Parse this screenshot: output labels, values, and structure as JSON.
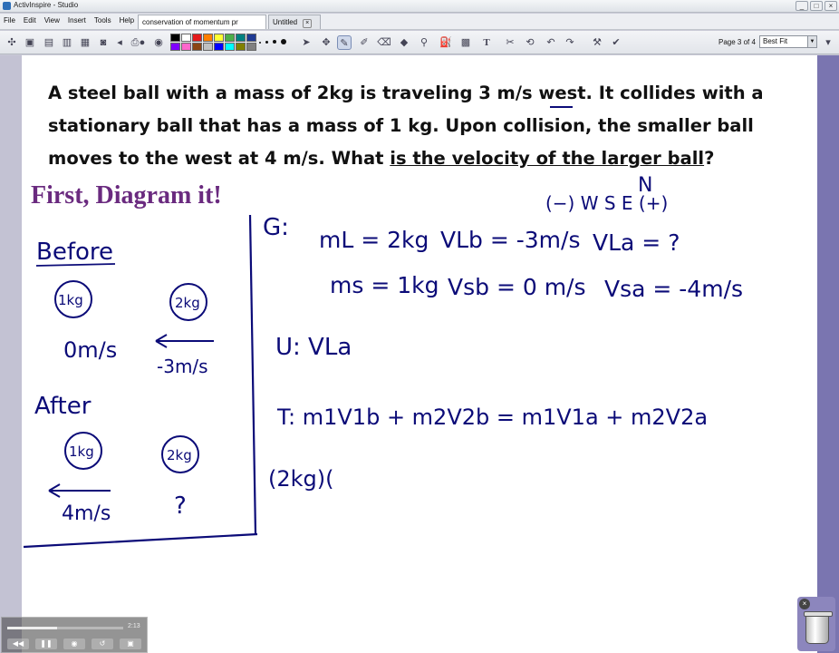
{
  "window": {
    "title": "ActivInspire - Studio",
    "controls": [
      "_",
      "□",
      "×"
    ]
  },
  "menu": [
    "File",
    "Edit",
    "View",
    "Insert",
    "Tools",
    "Help"
  ],
  "tabs": [
    {
      "label": "conservation of momentum pr"
    },
    {
      "label": "Untitled"
    }
  ],
  "toolbar": {
    "page_info": "Page 3 of 4",
    "zoom": "Best Fit",
    "palette": [
      "#000000",
      "#ffffff",
      "#e41a1c",
      "#ff7f00",
      "#ffff33",
      "#4daf4a",
      "#008080",
      "#1f3a93",
      "#7f00ff",
      "#ff66cc",
      "#8b4513",
      "#c0c0c0",
      "#0000ff",
      "#00ffff",
      "#808000",
      "#808080"
    ]
  },
  "page": {
    "question": {
      "part1": "A steel ball with a mass of 2kg is traveling 3 m/s west. It collides with a stationary ball that has a mass of 1 kg. Upon collision, the smaller ball moves to the west at 4 m/s. What ",
      "underlined": "is the velocity of the larger ball",
      "part2": "?"
    },
    "heading": "First, Diagram it!",
    "handwriting": {
      "before": "Before",
      "after": "After",
      "ball_small": "1kg",
      "ball_large": "2kg",
      "v_zero": "0m/s",
      "v_neg3": "-3m/s",
      "v_4": "4m/s",
      "unknown": "?",
      "compass": "(−) W  S  E (+)",
      "compass_n": "N",
      "given_label": "G:",
      "mL": "mL = 2kg",
      "vLb": "VLb = -3m/s",
      "vLa": "VLa = ?",
      "ms": "ms = 1kg",
      "vsb": "Vsb = 0 m/s",
      "vsa": "Vsa = -4m/s",
      "unknown_label": "U: VLa",
      "tool_eq": "T: m1V1b + m2V2b = m1V1a + m2V2a",
      "start": "(2kg)("
    }
  },
  "media": {
    "time": "2:13",
    "progress": 0.43
  }
}
